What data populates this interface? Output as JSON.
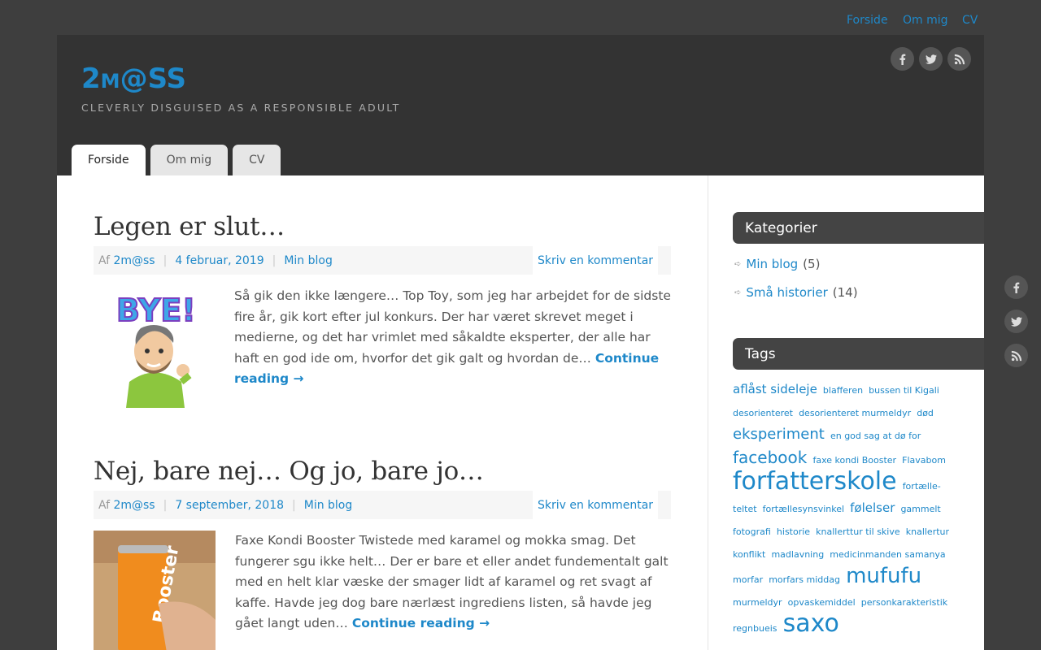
{
  "top_nav": [
    "Forside",
    "Om mig",
    "CV"
  ],
  "site": {
    "logo_big": "2",
    "logo_small": "M",
    "logo_rest": "@SS",
    "tagline": "CLEVERLY DISGUISED AS A RESPONSIBLE ADULT"
  },
  "social": [
    "facebook-icon",
    "twitter-icon",
    "rss-icon"
  ],
  "tabs": [
    "Forside",
    "Om mig",
    "CV"
  ],
  "posts": [
    {
      "title": "Legen er slut…",
      "by": "Af",
      "author": "2m@ss",
      "date": "4 februar, 2019",
      "category": "Min blog",
      "comment": "Skriv en kommentar",
      "excerpt": "Så gik den ikke længere… Top Toy, som jeg har arbejdet for de sidste fire år, gik kort efter jul konkurs. Der har været skrevet meget i medierne, og det har vrimlet med såkaldte eksperter, der alle har haft en god ide om, hvorfor det gik galt og hvordan de… ",
      "more": "Continue reading →"
    },
    {
      "title": "Nej, bare nej… Og jo, bare jo…",
      "by": "Af",
      "author": "2m@ss",
      "date": "7 september, 2018",
      "category": "Min blog",
      "comment": "Skriv en kommentar",
      "excerpt": "Faxe Kondi Booster Twistede med karamel og mokka smag. Det fungerer sgu ikke helt… Der er bare et eller andet fundementalt galt med en helt klar væske der smager lidt af karamel og ret svagt af kaffe. Havde jeg dog bare nærlæst ingrediens listen, så havde jeg gået langt uden… ",
      "more": "Continue reading →"
    }
  ],
  "sidebar": {
    "categories_title": "Kategorier",
    "categories": [
      {
        "name": "Min blog",
        "count": "(5)"
      },
      {
        "name": "Små historier",
        "count": "(14)"
      }
    ],
    "tags_title": "Tags",
    "tags": [
      {
        "t": "aflåst sideleje",
        "s": 15
      },
      {
        "t": "blafferen",
        "s": 11
      },
      {
        "t": "bussen til Kigali",
        "s": 11
      },
      {
        "t": "desorienteret",
        "s": 11
      },
      {
        "t": "desorienteret murmeldyr",
        "s": 11
      },
      {
        "t": "død",
        "s": 11
      },
      {
        "t": "eksperiment",
        "s": 18
      },
      {
        "t": "en god sag at dø for",
        "s": 11
      },
      {
        "t": "facebook",
        "s": 20
      },
      {
        "t": "faxe kondi Booster",
        "s": 11
      },
      {
        "t": "Flavabom",
        "s": 11
      },
      {
        "t": "forfatterskole",
        "s": 30
      },
      {
        "t": "fortælle-teltet",
        "s": 11
      },
      {
        "t": "fortællesynsvinkel",
        "s": 11
      },
      {
        "t": "følelser",
        "s": 15
      },
      {
        "t": "gammelt fotografi",
        "s": 11
      },
      {
        "t": "historie",
        "s": 11
      },
      {
        "t": "knallerttur til skive",
        "s": 11
      },
      {
        "t": "knallertur",
        "s": 11
      },
      {
        "t": "konflikt",
        "s": 11
      },
      {
        "t": "madlavning",
        "s": 11
      },
      {
        "t": "medicinmanden samanya",
        "s": 11
      },
      {
        "t": "morfar",
        "s": 11
      },
      {
        "t": "morfars middag",
        "s": 11
      },
      {
        "t": "mufufu",
        "s": 26
      },
      {
        "t": "murmeldyr",
        "s": 11
      },
      {
        "t": "opvaskemiddel",
        "s": 11
      },
      {
        "t": "personkarakteristik",
        "s": 11
      },
      {
        "t": "regnbueis",
        "s": 11
      },
      {
        "t": "saxo",
        "s": 30
      }
    ]
  }
}
